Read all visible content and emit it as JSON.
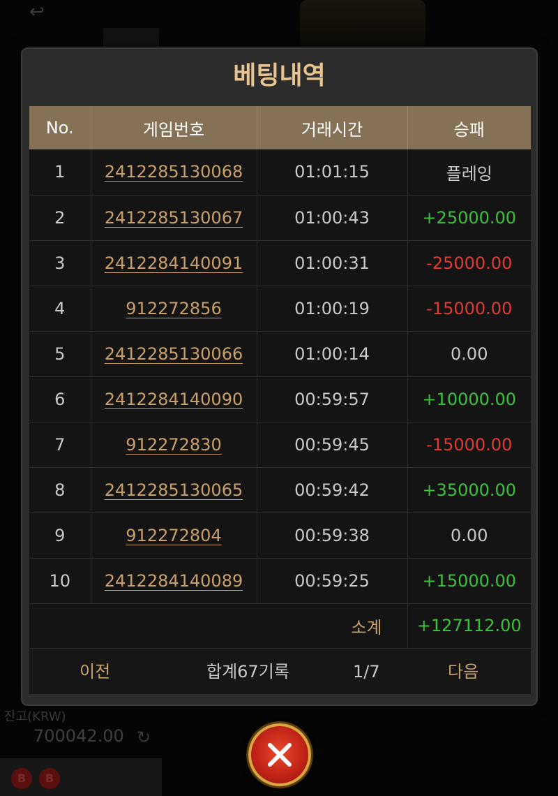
{
  "background": {
    "back_icon": "back-arrow-icon",
    "balance_label": "잔고(KRW)",
    "balance_value": "700042.00",
    "refresh_icon": "refresh-icon",
    "chip_1": "B",
    "chip_2": "B"
  },
  "modal": {
    "title": "베팅내역",
    "columns": [
      "No.",
      "게임번호",
      "거래시간",
      "승패"
    ],
    "rows": [
      {
        "no": "1",
        "game_id": "2412285130068",
        "time": "01:01:15",
        "result": "플레잉",
        "status": "neutral"
      },
      {
        "no": "2",
        "game_id": "2412285130067",
        "time": "01:00:43",
        "result": "+25000.00",
        "status": "win"
      },
      {
        "no": "3",
        "game_id": "2412284140091",
        "time": "01:00:31",
        "result": "-25000.00",
        "status": "loss"
      },
      {
        "no": "4",
        "game_id": "912272856",
        "time": "01:00:19",
        "result": "-15000.00",
        "status": "loss"
      },
      {
        "no": "5",
        "game_id": "2412285130066",
        "time": "01:00:14",
        "result": "0.00",
        "status": "neutral"
      },
      {
        "no": "6",
        "game_id": "2412284140090",
        "time": "00:59:57",
        "result": "+10000.00",
        "status": "win"
      },
      {
        "no": "7",
        "game_id": "912272830",
        "time": "00:59:45",
        "result": "-15000.00",
        "status": "loss"
      },
      {
        "no": "8",
        "game_id": "2412285130065",
        "time": "00:59:42",
        "result": "+35000.00",
        "status": "win"
      },
      {
        "no": "9",
        "game_id": "912272804",
        "time": "00:59:38",
        "result": "0.00",
        "status": "neutral"
      },
      {
        "no": "10",
        "game_id": "2412284140089",
        "time": "00:59:25",
        "result": "+15000.00",
        "status": "win"
      }
    ],
    "subtotal_label": "소계",
    "subtotal_value": "+127112.00",
    "pager": {
      "prev": "이전",
      "total": "합계67기록",
      "page": "1/7",
      "next": "다음"
    }
  },
  "colors": {
    "title": "#e7c38f",
    "header_bg": "#857256",
    "link": "#c9a06a",
    "win": "#3ec03e",
    "loss": "#e03a35",
    "neutral": "#c9c9c9"
  },
  "close_icon": "close-x-icon"
}
